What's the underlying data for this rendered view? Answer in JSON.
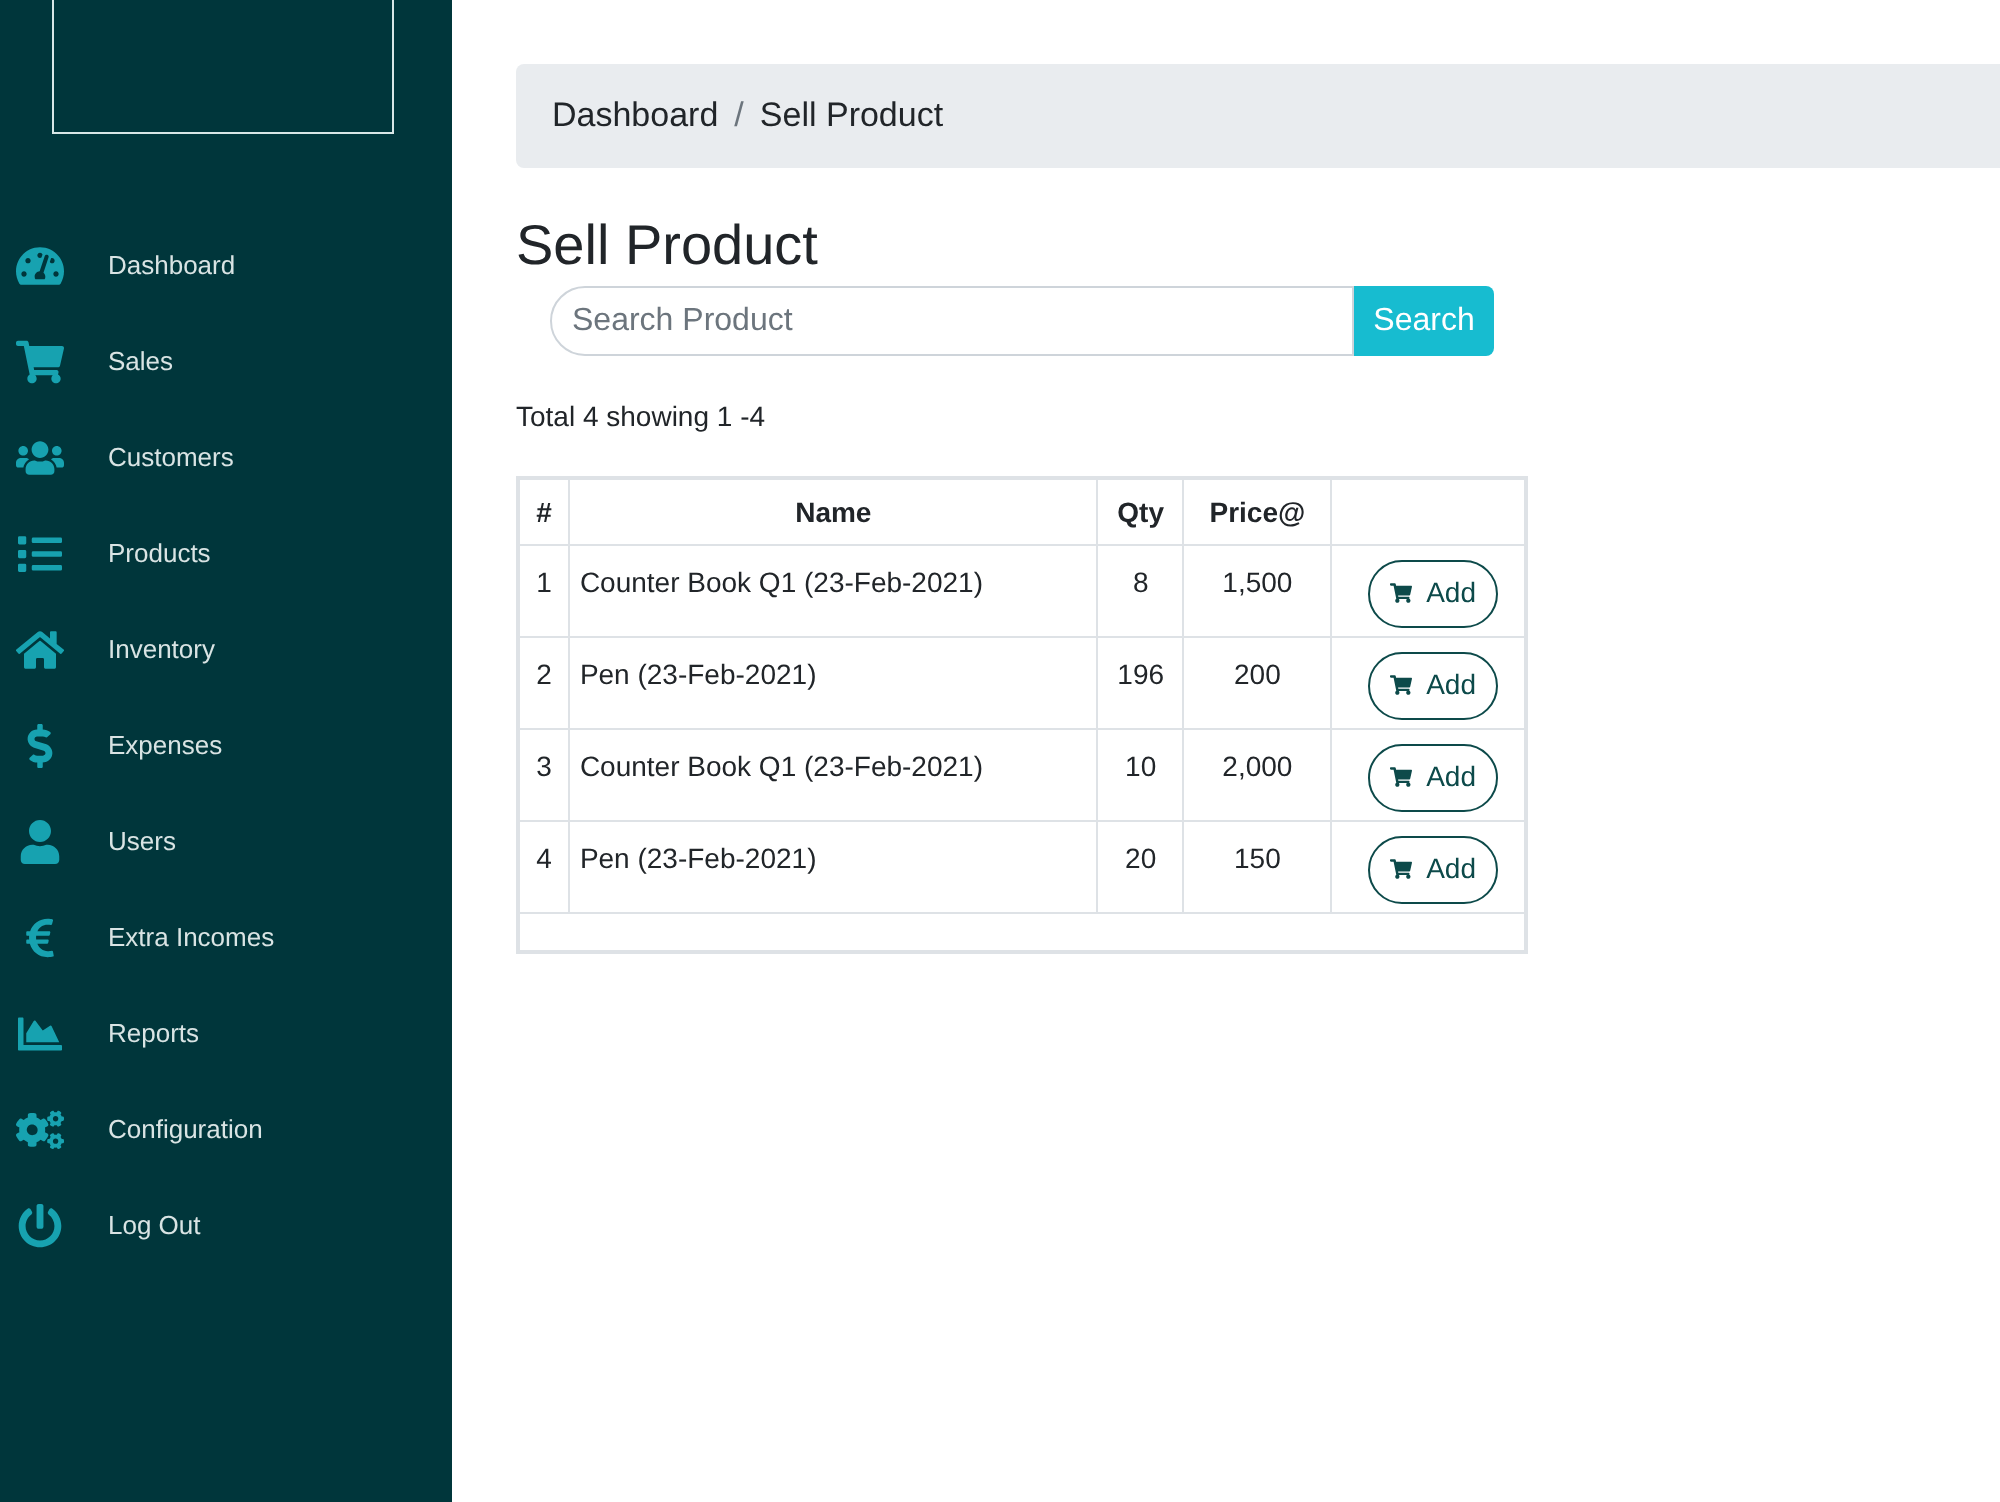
{
  "sidebar": {
    "items": [
      {
        "label": "Dashboard"
      },
      {
        "label": "Sales"
      },
      {
        "label": "Customers"
      },
      {
        "label": "Products"
      },
      {
        "label": "Inventory"
      },
      {
        "label": "Expenses"
      },
      {
        "label": "Users"
      },
      {
        "label": "Extra Incomes"
      },
      {
        "label": "Reports"
      },
      {
        "label": "Configuration"
      },
      {
        "label": "Log Out"
      }
    ]
  },
  "breadcrumb": {
    "items": [
      "Dashboard",
      "Sell Product"
    ],
    "separator": "/"
  },
  "title": "Sell Product",
  "search": {
    "placeholder": "Search Product",
    "button": "Search"
  },
  "summary": "Total 4 showing 1 -4",
  "table": {
    "columns": [
      "#",
      "Name",
      "Qty",
      "Price@"
    ],
    "rows": [
      {
        "cells": [
          "1",
          "Counter Book Q1 (23-Feb-2021)",
          "8",
          "1,500"
        ],
        "action": "Add"
      },
      {
        "cells": [
          "2",
          "Pen (23-Feb-2021)",
          "196",
          "200"
        ],
        "action": "Add"
      },
      {
        "cells": [
          "3",
          "Counter Book Q1 (23-Feb-2021)",
          "10",
          "2,000"
        ],
        "action": "Add"
      },
      {
        "cells": [
          "4",
          "Pen (23-Feb-2021)",
          "20",
          "150"
        ],
        "action": "Add"
      }
    ]
  }
}
